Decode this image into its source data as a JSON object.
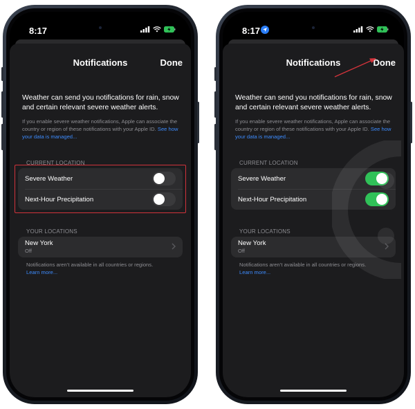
{
  "colors": {
    "background": "#ffffff",
    "sheet": "#1c1c1e",
    "group": "#2c2c2e",
    "link": "#3d8bfd",
    "toggle_on": "#30c158",
    "toggle_off": "#3a3a3c",
    "highlight": "#d2333b"
  },
  "phones": [
    {
      "status": {
        "time": "8:17",
        "location_arrow": false
      },
      "nav": {
        "title": "Notifications",
        "done": "Done"
      },
      "intro": "Weather can send you notifications for rain, snow and certain relevant severe weather alerts.",
      "fine_print": "If you enable severe weather notifications, Apple can associate the country or region of these notifications with your Apple ID.",
      "fine_link": "See how your data is managed...",
      "current_location": {
        "header": "CURRENT LOCATION",
        "rows": [
          {
            "label": "Severe Weather",
            "on": false
          },
          {
            "label": "Next-Hour Precipitation",
            "on": false
          }
        ]
      },
      "your_locations": {
        "header": "YOUR LOCATIONS",
        "items": [
          {
            "name": "New York",
            "status": "Off"
          }
        ]
      },
      "footer": "Notifications aren’t available in all countries or regions.",
      "footer_link": "Learn more..."
    },
    {
      "status": {
        "time": "8:17",
        "location_arrow": true
      },
      "nav": {
        "title": "Notifications",
        "done": "Done"
      },
      "intro": "Weather can send you notifications for rain, snow and certain relevant severe weather alerts.",
      "fine_print": "If you enable severe weather notifications, Apple can associate the country or region of these notifications with your Apple ID.",
      "fine_link": "See how your data is managed...",
      "current_location": {
        "header": "CURRENT LOCATION",
        "rows": [
          {
            "label": "Severe Weather",
            "on": true
          },
          {
            "label": "Next-Hour Precipitation",
            "on": true
          }
        ]
      },
      "your_locations": {
        "header": "YOUR LOCATIONS",
        "items": [
          {
            "name": "New York",
            "status": "Off"
          }
        ]
      },
      "footer": "Notifications aren’t available in all countries or regions.",
      "footer_link": "Learn more..."
    }
  ]
}
